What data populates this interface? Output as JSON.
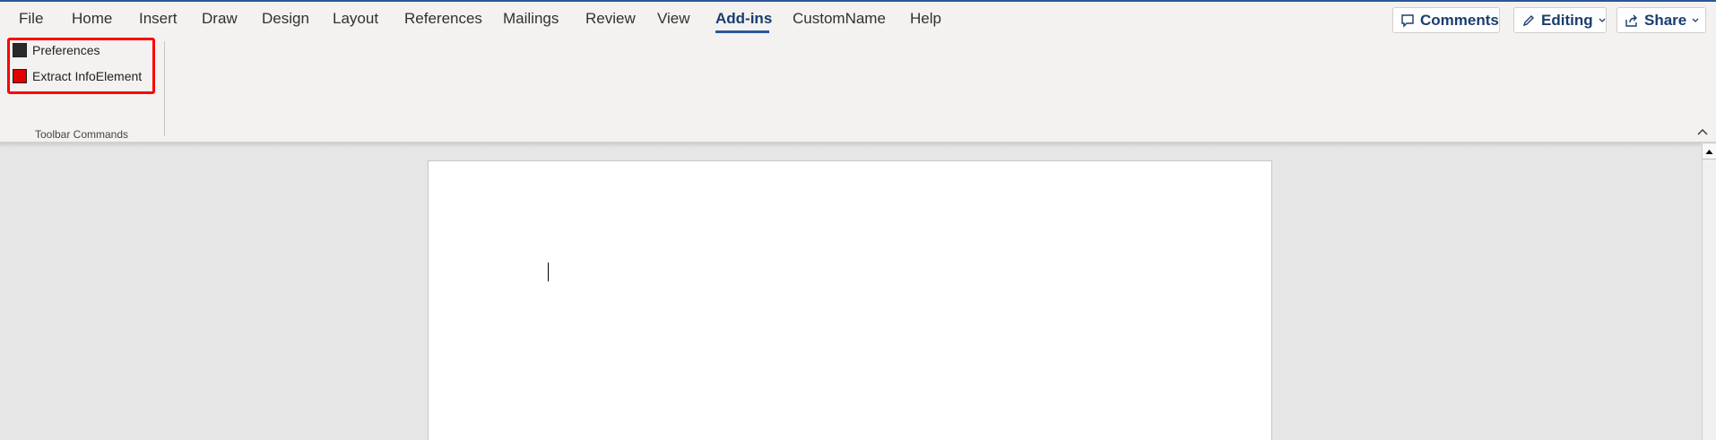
{
  "tabs": [
    {
      "label": "File"
    },
    {
      "label": "Home"
    },
    {
      "label": "Insert"
    },
    {
      "label": "Draw"
    },
    {
      "label": "Design"
    },
    {
      "label": "Layout"
    },
    {
      "label": "References"
    },
    {
      "label": "Mailings"
    },
    {
      "label": "Review"
    },
    {
      "label": "View"
    },
    {
      "label": "Add-ins"
    },
    {
      "label": "CustomName"
    },
    {
      "label": "Help"
    }
  ],
  "active_tab": "Add-ins",
  "actions": {
    "comments": "Comments",
    "editing": "Editing",
    "share": "Share"
  },
  "ribbon": {
    "commands": [
      {
        "label": "Preferences",
        "icon": "black-square-icon"
      },
      {
        "label": "Extract InfoElement",
        "icon": "red-square-icon"
      }
    ],
    "group_label": "Toolbar Commands"
  },
  "colors": {
    "accent": "#2b579a",
    "highlight": "#ff0000"
  }
}
